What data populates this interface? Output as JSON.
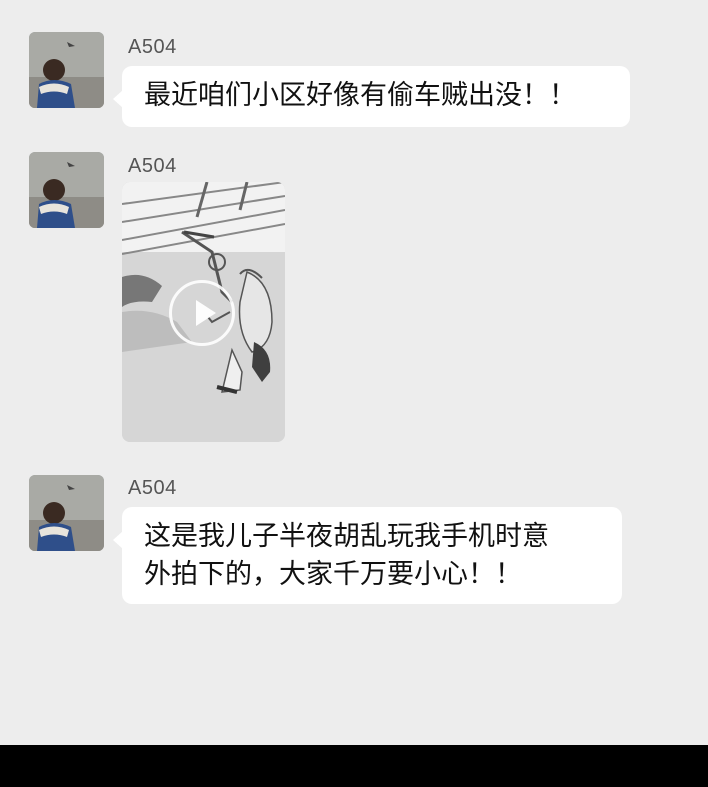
{
  "messages": [
    {
      "sender": "A504",
      "type": "text",
      "text": "最近咱们小区好像有偷车贼出没！！"
    },
    {
      "sender": "A504",
      "type": "video",
      "thumbnail_icon": "play-icon"
    },
    {
      "sender": "A504",
      "type": "text",
      "lines": [
        "这是我儿子半夜胡乱玩我手机时意",
        "外拍下的，大家千万要小心！！"
      ]
    }
  ],
  "colors": {
    "background": "#ededed",
    "bubble": "#ffffff",
    "bottom_bar": "#000000"
  }
}
